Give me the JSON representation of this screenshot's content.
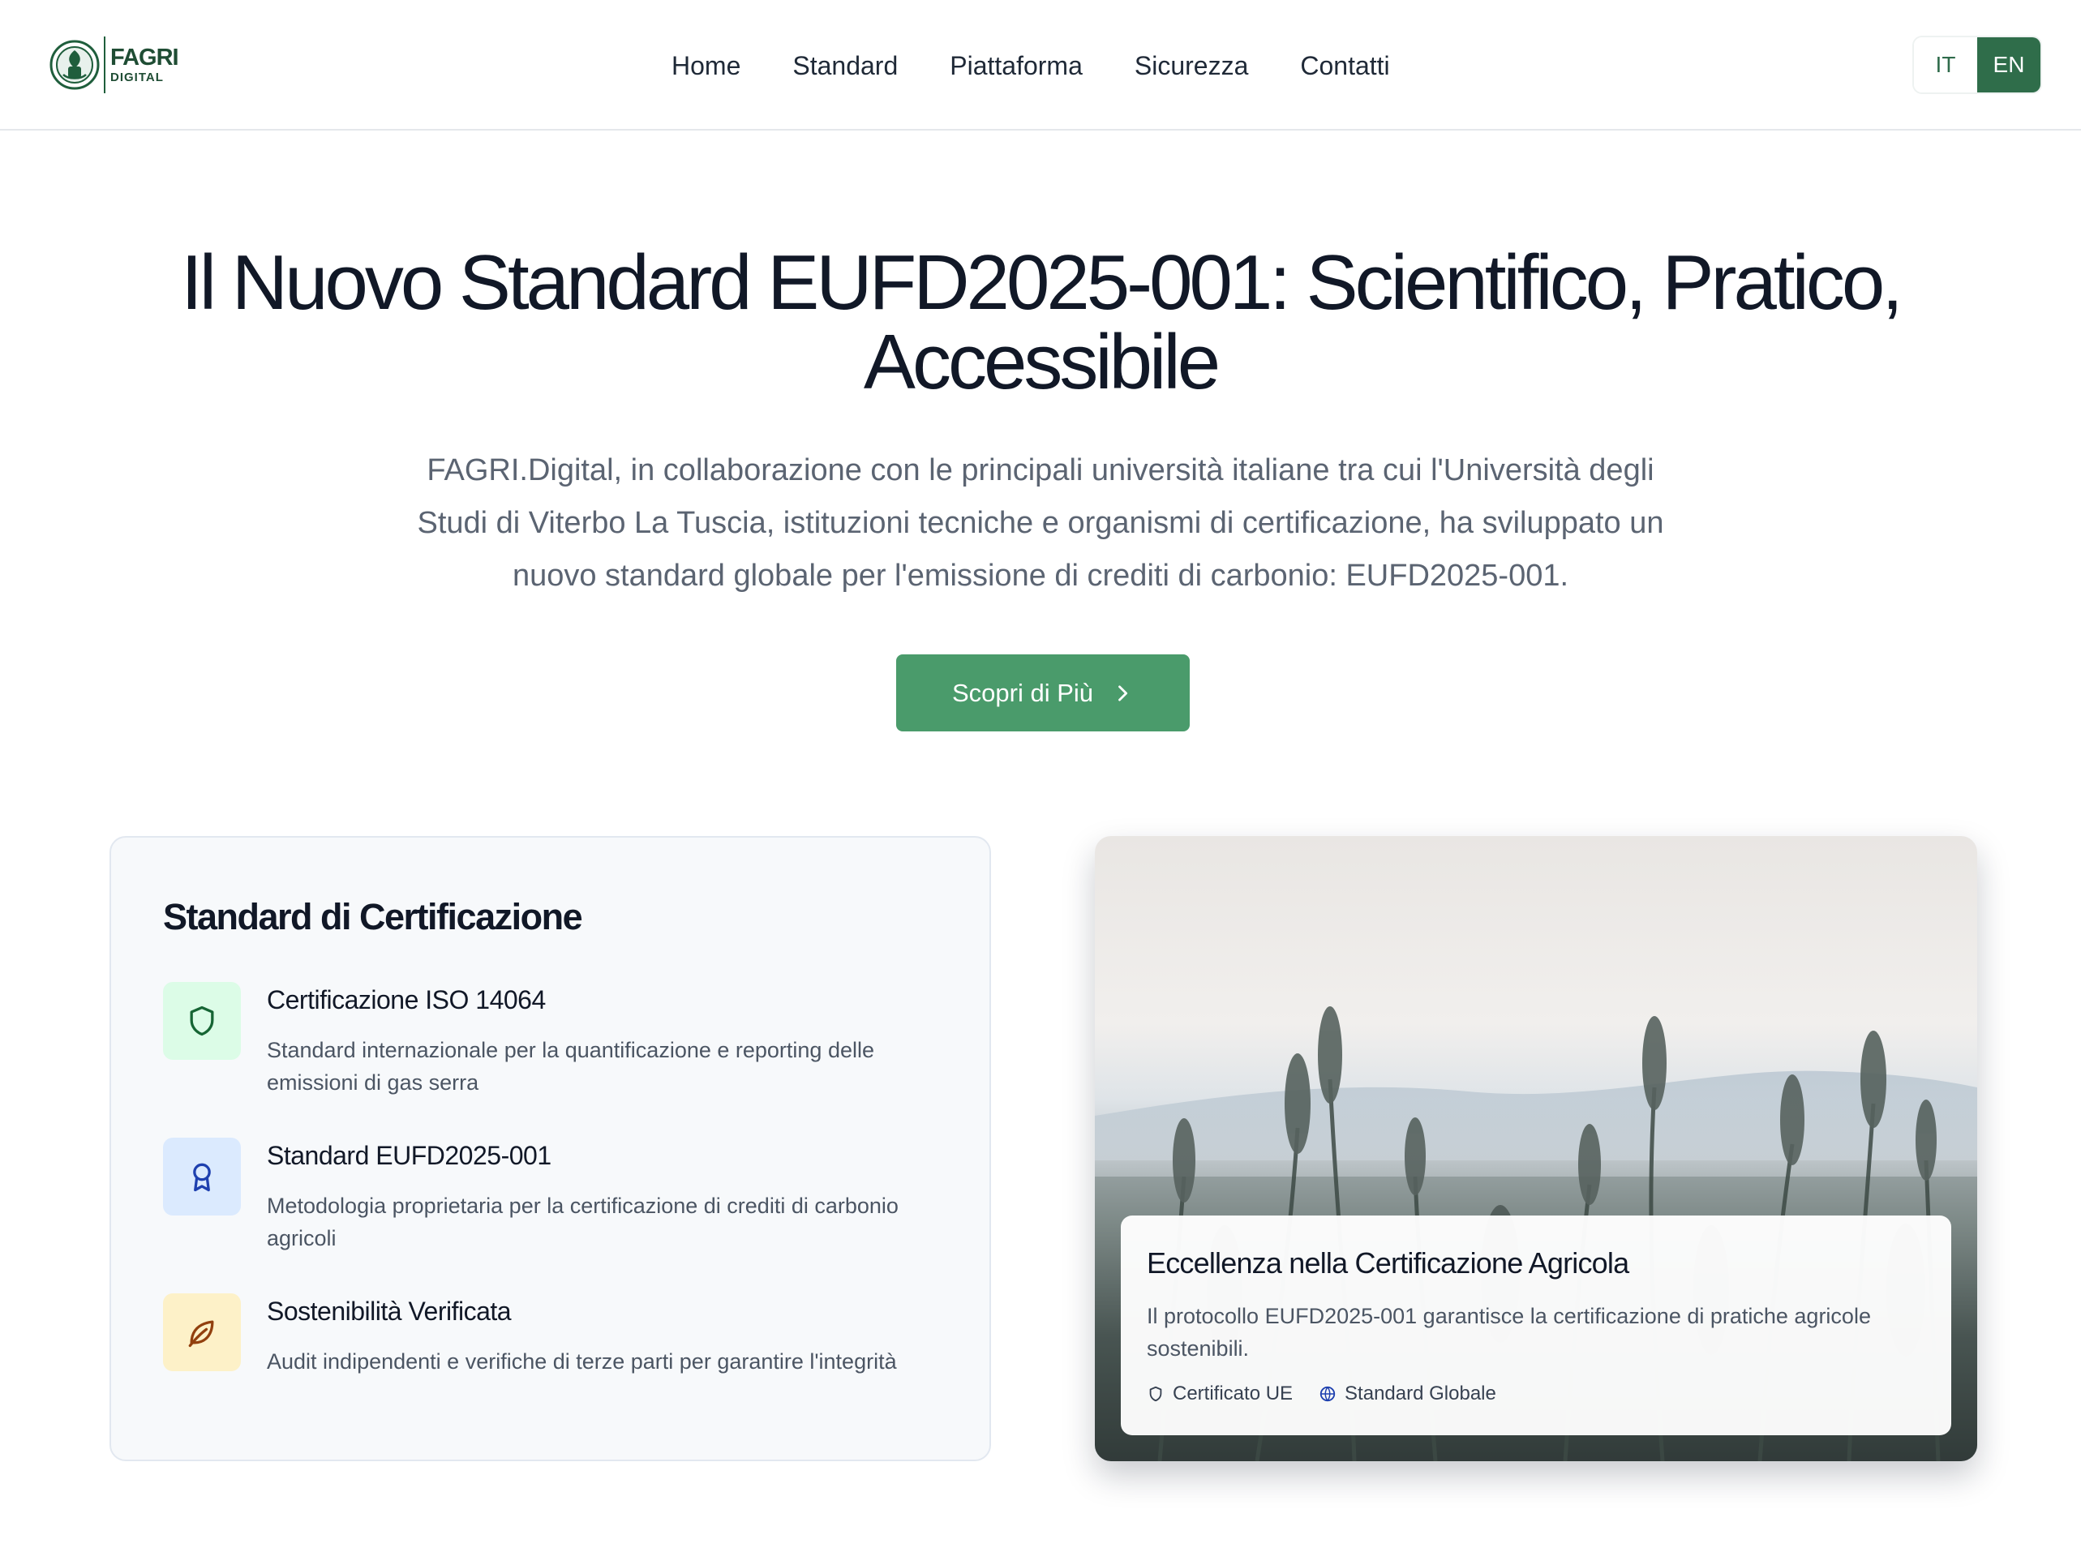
{
  "header": {
    "logo": {
      "line1": "FAGRI",
      "line2": "DIGITAL"
    },
    "nav": [
      "Home",
      "Standard",
      "Piattaforma",
      "Sicurezza",
      "Contatti"
    ],
    "lang": {
      "it": "IT",
      "en": "EN",
      "active": "EN"
    }
  },
  "hero": {
    "title_line1": "Il Nuovo Standard EUFD2025-001: Scientifico, Pratico,",
    "title_line2": "Accessibile",
    "subtitle": "FAGRI.Digital, in collaborazione con le principali università italiane tra cui l'Università degli Studi di Viterbo La Tuscia, istituzioni tecniche e organismi di certificazione, ha sviluppato un nuovo standard globale per l'emissione di crediti di carbonio: EUFD2025-001.",
    "cta_label": "Scopri di Più"
  },
  "certifications": {
    "title": "Standard di Certificazione",
    "items": [
      {
        "icon": "shield-icon",
        "name": "Certificazione ISO 14064",
        "desc": "Standard internazionale per la quantificazione e reporting delle emissioni di gas serra",
        "icon_bg": "#dcfce7",
        "icon_color": "#166534"
      },
      {
        "icon": "award-icon",
        "name": "Standard EUFD2025-001",
        "desc": "Metodologia proprietaria per la certificazione di crediti di carbonio agricoli",
        "icon_bg": "#dbeafe",
        "icon_color": "#1e40af"
      },
      {
        "icon": "leaf-icon",
        "name": "Sostenibilità Verificata",
        "desc": "Audit indipendenti e verifiche di terze parti per garantire l'integrità",
        "icon_bg": "#fdf1c8",
        "icon_color": "#92400e"
      }
    ]
  },
  "feature": {
    "title": "Eccellenza nella Certificazione Agricola",
    "desc": "Il protocollo EUFD2025-001 garantisce la certificazione di pratiche agricole sostenibili.",
    "badges": [
      {
        "icon": "shield-icon",
        "label": "Certificato UE"
      },
      {
        "icon": "globe-icon",
        "label": "Standard Globale"
      }
    ]
  },
  "colors": {
    "brand": "#2f6d4a",
    "cta": "#4a9b6b"
  }
}
